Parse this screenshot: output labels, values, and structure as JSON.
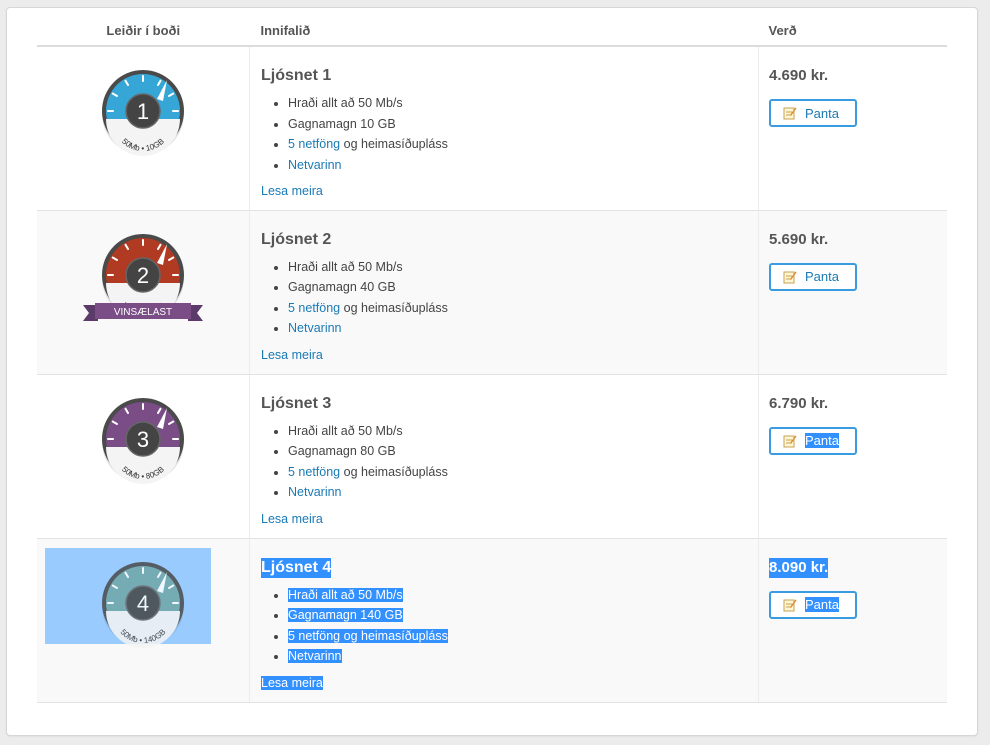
{
  "headers": {
    "plans": "Leiðir í boði",
    "contents": "Innifalið",
    "price": "Verð"
  },
  "plans": [
    {
      "name": "Ljósnet 1",
      "number": "1",
      "gauge_color": "#35a6d6",
      "gauge_label": "50Mb • 10GB",
      "badge": "",
      "features": {
        "speed": "Hraði allt að 50 Mb/s",
        "data": "Gagnamagn 10 GB",
        "email_link": "5 netföng",
        "email_rest": " og heimasíðupláss",
        "security": "Netvarinn"
      },
      "more": "Lesa meira",
      "price": "4.690 kr.",
      "order": "Panta"
    },
    {
      "name": "Ljósnet 2",
      "number": "2",
      "gauge_color": "#b03a22",
      "gauge_label": "50Mb • 40GB",
      "badge": "VINSÆLAST",
      "features": {
        "speed": "Hraði allt að 50 Mb/s",
        "data": "Gagnamagn 40 GB",
        "email_link": "5 netföng",
        "email_rest": " og heimasíðupláss",
        "security": "Netvarinn"
      },
      "more": "Lesa meira",
      "price": "5.690 kr.",
      "order": "Panta"
    },
    {
      "name": "Ljósnet 3",
      "number": "3",
      "gauge_color": "#7a4d87",
      "gauge_label": "50Mb • 80GB",
      "badge": "",
      "features": {
        "speed": "Hraði allt að 50 Mb/s",
        "data": "Gagnamagn 80 GB",
        "email_link": "5 netföng",
        "email_rest": " og heimasíðupláss",
        "security": "Netvarinn"
      },
      "more": "Lesa meira",
      "price": "6.790 kr.",
      "order": "Panta"
    },
    {
      "name": "Ljósnet 4",
      "number": "4",
      "gauge_color": "#6fa7a8",
      "gauge_label": "50Mb • 140GB",
      "badge": "",
      "features": {
        "speed": "Hraði allt að 50 Mb/s",
        "data": "Gagnamagn 140 GB",
        "email_link": "5 netföng",
        "email_rest": " og heimasíðupláss",
        "security": "Netvarinn"
      },
      "more": "Lesa meira",
      "price": "8.090 kr.",
      "order": "Panta"
    }
  ],
  "icons": {
    "order": "edit-note-icon"
  },
  "colors": {
    "link": "#1a7ab5",
    "button_border": "#3a9be0",
    "selection": "#3390ff"
  }
}
